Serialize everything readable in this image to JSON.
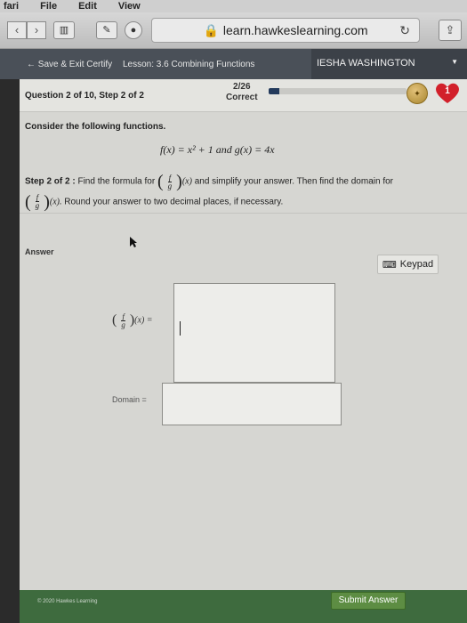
{
  "menubar": {
    "items": [
      "fari",
      "File",
      "Edit",
      "View"
    ]
  },
  "browser": {
    "url": "learn.hawkeslearning.com",
    "back_icon": "chevron-left-icon",
    "forward_icon": "chevron-right-icon",
    "reload_icon": "reload-icon",
    "share_icon": "share-icon"
  },
  "site_nav": {
    "save_label": "Save & Exit Certify",
    "lesson": "Lesson: 3.6 Combining Functions",
    "user": "IESHA WASHINGTON"
  },
  "question_header": {
    "question": "Question 2 of 10, Step 2 of 2",
    "score": "2/26",
    "status": "Correct",
    "progress_fraction": 0.08,
    "hearts": "1"
  },
  "question": {
    "prompt": "Consider the following functions.",
    "equation": "f(x) = x² + 1 and g(x) = 4x",
    "step_label": "Step 2 of 2 :",
    "step_text_1": "Find the formula for",
    "step_text_2": "and simplify your answer. Then find the domain for",
    "step_text_3": "Round your answer to two decimal places, if necessary.",
    "frac_num": "f",
    "frac_den": "g",
    "func_arg": "(x)",
    "func_arg_dot": "(x)."
  },
  "answer": {
    "label": "Answer",
    "keypad_label": "Keypad",
    "fx_equals": "(x) =",
    "domain_label": "Domain ="
  },
  "footer": {
    "copyright": "© 2020 Hawkes Learning",
    "submit_label": "Submit Answer"
  },
  "colors": {
    "progress": "#233a5c",
    "heart": "#d2202a",
    "submit": "#5d8d43"
  }
}
